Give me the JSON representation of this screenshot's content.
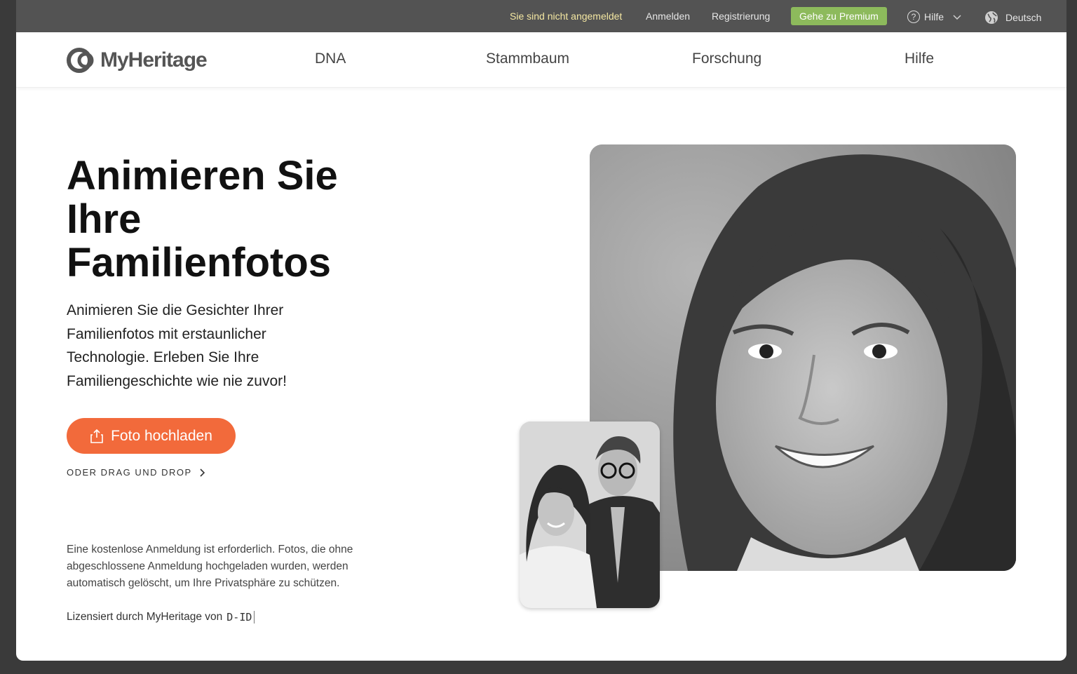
{
  "topbar": {
    "status": "Sie sind nicht angemeldet",
    "login": "Anmelden",
    "register": "Registrierung",
    "premium": "Gehe zu Premium",
    "help": "Hilfe",
    "language": "Deutsch"
  },
  "nav": {
    "logo": "MyHeritage",
    "items": [
      "DNA",
      "Stammbaum",
      "Forschung",
      "Hilfe"
    ]
  },
  "hero": {
    "title": "Animieren Sie Ihre Familienfotos",
    "subtitle": "Animieren Sie die Gesichter Ihrer Familienfotos mit erstaunlicher Technologie. Erleben Sie Ihre Familiengeschichte wie nie zuvor!",
    "upload_button": "Foto hochladen",
    "drag_drop": "ODER DRAG UND DROP",
    "note": "Eine kostenlose Anmeldung ist erforderlich. Fotos, die ohne abgeschlossene Anmeldung hochgeladen wurden, werden automatisch gelöscht, um Ihre Privatsphäre zu schützen.",
    "license": "Lizensiert durch MyHeritage von",
    "license_brand": "D-ID"
  },
  "colors": {
    "accent": "#f26a3b",
    "premium": "#8dba5c",
    "topbar": "#535353"
  }
}
